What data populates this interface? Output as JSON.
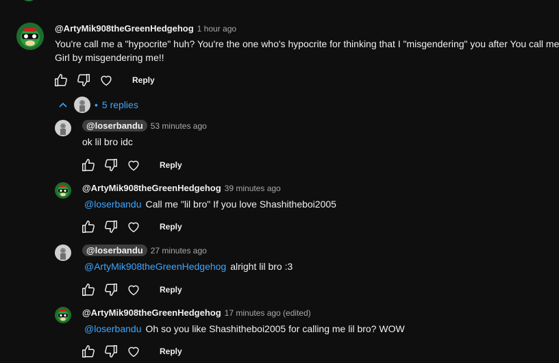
{
  "thread": {
    "top": {
      "author": "@ArtyMik908theGreenHedgehog",
      "time": "1 hour ago",
      "text_line1": "You're call me a \"hypocrite\" huh? You're the one who's hypocrite for thinking that I \"misgendering\" you after You call me",
      "text_line2": "Girl by misgendering me!!",
      "reply_label": "Reply"
    },
    "replies_toggle": {
      "dot": "•",
      "label": "5 replies"
    },
    "replies": [
      {
        "author": "@loserbandu",
        "time": "53 minutes ago",
        "mention": "",
        "text": "ok lil bro idc",
        "reply_label": "Reply"
      },
      {
        "author": "@ArtyMik908theGreenHedgehog",
        "time": "39 minutes ago",
        "mention": "@loserbandu",
        "text": "Call me \"lil bro\" If you love Shashitheboi2005",
        "reply_label": "Reply"
      },
      {
        "author": "@loserbandu",
        "time": "27 minutes ago",
        "mention": "@ArtyMik908theGreenHedgehog",
        "text": "alright lil bro :3",
        "reply_label": "Reply"
      },
      {
        "author": "@ArtyMik908theGreenHedgehog",
        "time": "17 minutes ago (edited)",
        "mention": "@loserbandu",
        "text": "Oh so you like Shashitheboi2005 for calling me lil bro? WOW",
        "reply_label": "Reply"
      }
    ]
  },
  "colors": {
    "background": "#0f0f0f",
    "link": "#3ea6ff",
    "muted": "#aaaaaa",
    "pill": "#3f3f3f"
  },
  "icons": [
    "like-icon",
    "dislike-icon",
    "heart-icon",
    "chevron-up-icon"
  ]
}
